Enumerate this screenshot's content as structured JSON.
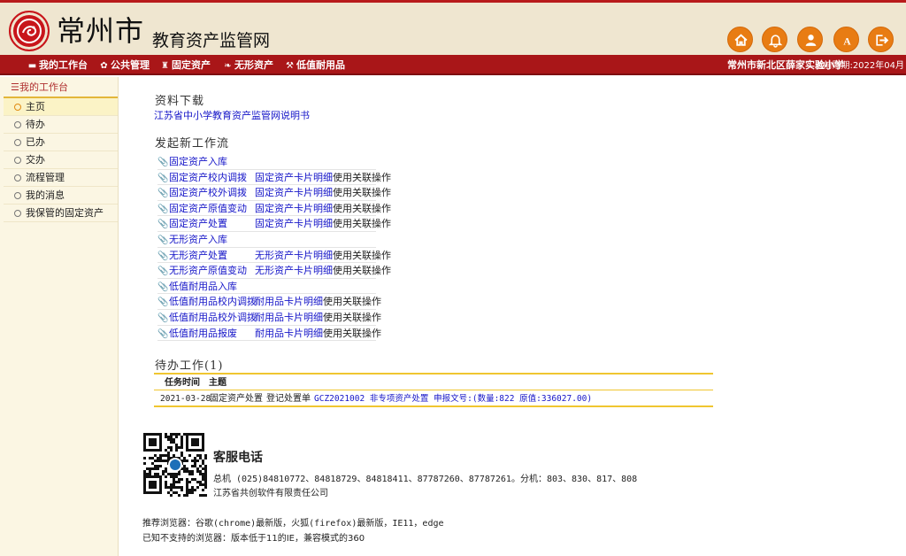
{
  "header": {
    "city": "常州市",
    "system_name": "教育资产监管网",
    "icons": [
      "home-icon",
      "bell-icon",
      "user-icon",
      "font-size-icon",
      "logout-icon"
    ],
    "accent": "#e87c13"
  },
  "menubar": {
    "items": [
      {
        "label": "我的工作台",
        "icon": "desk-icon"
      },
      {
        "label": "公共管理",
        "icon": "gear-icon"
      },
      {
        "label": "固定资产",
        "icon": "building-icon"
      },
      {
        "label": "无形资产",
        "icon": "leaf-icon"
      },
      {
        "label": "低值耐用品",
        "icon": "wrench-icon"
      }
    ],
    "school": "常州市新北区薛家实验小学",
    "period": "当前账期:2022年04月",
    "color": "#a91618"
  },
  "sidebar": {
    "title": "我的工作台",
    "items": [
      {
        "label": "主页"
      },
      {
        "label": "待办"
      },
      {
        "label": "已办"
      },
      {
        "label": "交办"
      },
      {
        "label": "流程管理"
      },
      {
        "label": "我的消息"
      },
      {
        "label": "我保管的固定资产"
      }
    ]
  },
  "downloads": {
    "title": "资料下载",
    "link": "江苏省中小学教育资产监管网说明书"
  },
  "workflows": {
    "title": "发起新工作流",
    "op_suffix": "使用关联操作",
    "items": [
      {
        "name": "固定资产入库",
        "card": ""
      },
      {
        "name": "固定资产校内调拨",
        "card": "固定资产卡片明细"
      },
      {
        "name": "固定资产校外调拨",
        "card": "固定资产卡片明细"
      },
      {
        "name": "固定资产原值变动",
        "card": "固定资产卡片明细"
      },
      {
        "name": "固定资产处置",
        "card": "固定资产卡片明细"
      },
      {
        "name": "无形资产入库",
        "card": ""
      },
      {
        "name": "无形资产处置",
        "card": "无形资产卡片明细"
      },
      {
        "name": "无形资产原值变动",
        "card": "无形资产卡片明细"
      },
      {
        "name": "低值耐用品入库",
        "card": ""
      },
      {
        "name": "低值耐用品校内调拨",
        "card": "耐用品卡片明细"
      },
      {
        "name": "低值耐用品校外调拨",
        "card": "耐用品卡片明细"
      },
      {
        "name": "低值耐用品报废",
        "card": "耐用品卡片明细"
      }
    ]
  },
  "todo": {
    "title": "待办工作(1)",
    "columns": [
      "任务时间",
      "主题"
    ],
    "rows": [
      {
        "date": "2021-03-28",
        "type": "固定资产处置",
        "form": "登记处置单",
        "detail": "GCZ2021002 非专项资产处置 申报文号:(数量:822 原值:336027.00)"
      }
    ]
  },
  "service": {
    "title": "客服电话",
    "phones": "总机 (025)84810772、84818729、84818411、87787260、87787261。分机：803、830、817、808",
    "company": "江苏省共创软件有限责任公司"
  },
  "browser": {
    "recommended": "推荐浏览器：谷歌(chrome)最新版，火狐(firefox)最新版，IE11，edge",
    "unsupported": "已知不支持的浏览器：版本低于11的IE，兼容模式的360"
  }
}
